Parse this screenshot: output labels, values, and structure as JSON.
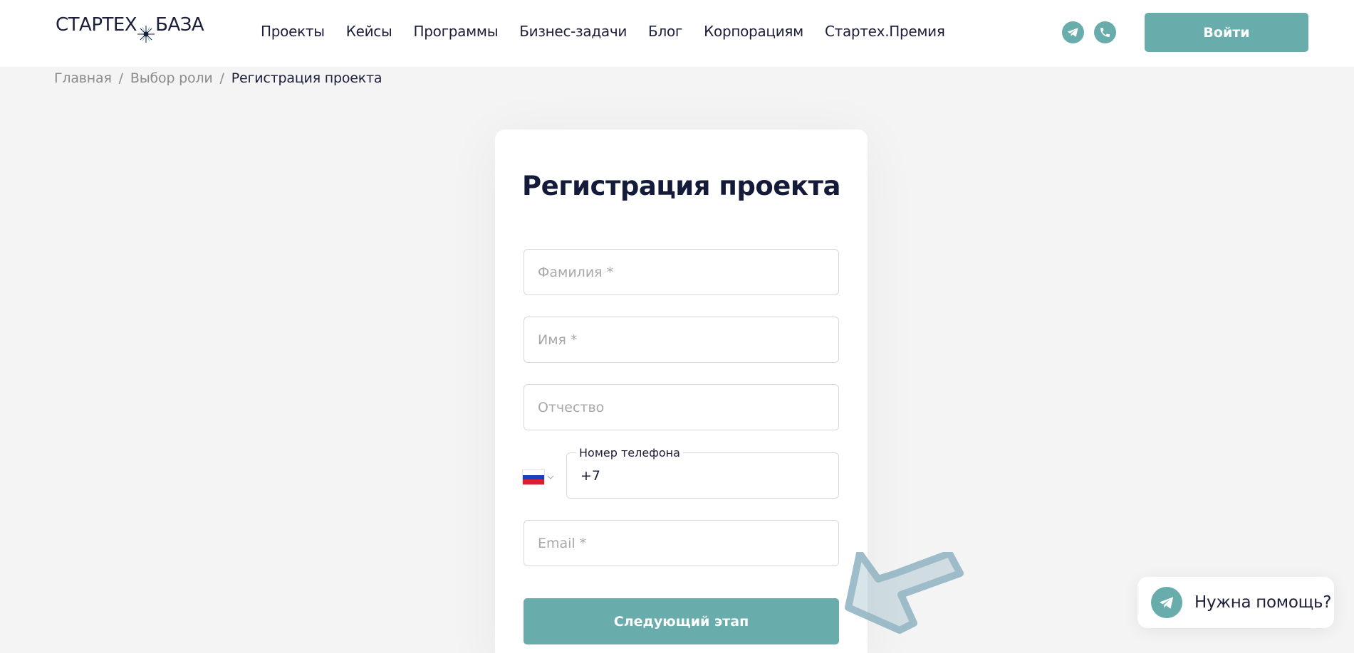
{
  "header": {
    "logo": {
      "left": "СТАРТЕХ",
      "right": "БАЗА"
    },
    "nav": [
      {
        "label": "Проекты",
        "name": "nav-projects"
      },
      {
        "label": "Кейсы",
        "name": "nav-cases"
      },
      {
        "label": "Программы",
        "name": "nav-programs"
      },
      {
        "label": "Бизнес-задачи",
        "name": "nav-business-tasks"
      },
      {
        "label": "Блог",
        "name": "nav-blog"
      },
      {
        "label": "Корпорациям",
        "name": "nav-corporations"
      },
      {
        "label": "Стартех.Премия",
        "name": "nav-startech-award"
      }
    ],
    "telegram_icon": "telegram-icon",
    "phone_icon": "phone-icon",
    "login_label": "Войти",
    "accent_color": "#68acac"
  },
  "breadcrumb": {
    "items": [
      "Главная",
      "Выбор роли",
      "Регистрация проекта"
    ],
    "separator": "/"
  },
  "form": {
    "title": "Регистрация проекта",
    "last_name": {
      "placeholder": "Фамилия *",
      "value": ""
    },
    "first_name": {
      "placeholder": "Имя *",
      "value": ""
    },
    "middle_name": {
      "placeholder": "Отчество",
      "value": ""
    },
    "phone": {
      "label": "Номер телефона",
      "value": "+7",
      "country_icon": "russia-flag-icon"
    },
    "email": {
      "placeholder": "Email *",
      "value": ""
    },
    "next_label": "Следующий этап"
  },
  "help": {
    "label": "Нужна помощь?",
    "icon": "telegram-icon"
  }
}
